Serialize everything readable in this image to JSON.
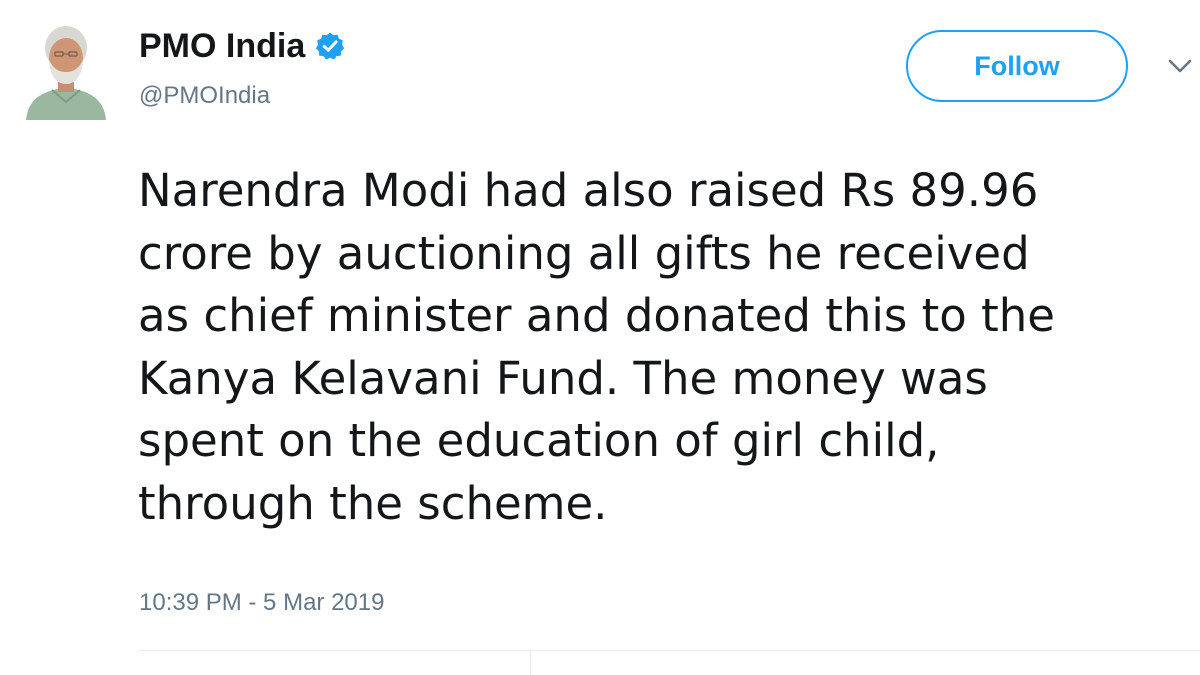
{
  "tweet": {
    "author": {
      "display_name": "PMO India",
      "handle": "@PMOIndia",
      "verified_icon": "verified-badge-icon",
      "avatar_icon": "profile-avatar"
    },
    "follow_label": "Follow",
    "menu_icon": "chevron-down-icon",
    "text": "Narendra Modi had also raised Rs 89.96\ncrore by auctioning all gifts he received\nas chief minister and donated this to the\nKanya Kelavani Fund. The money was\nspent on the education of girl child,\nthrough the scheme.",
    "timestamp": "10:39 PM - 5 Mar 2019"
  },
  "colors": {
    "accent": "#1da1f2",
    "text": "#14171a",
    "secondary": "#657786",
    "divider": "#e6ecf0"
  }
}
